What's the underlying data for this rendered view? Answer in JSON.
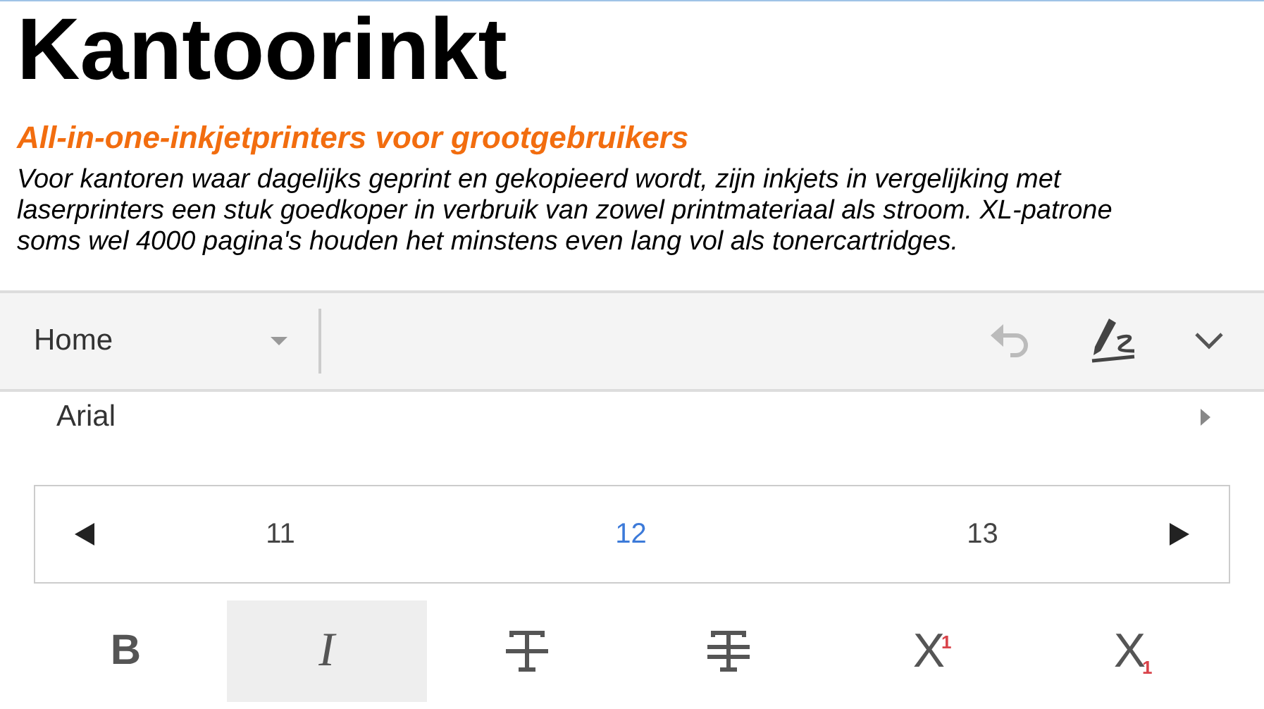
{
  "document": {
    "title": "Kantoorinkt",
    "subtitle": "All-in-one-inkjetprinters voor grootgebruikers",
    "paragraph_lines": [
      "Voor kantoren waar dagelijks geprint en gekopieerd wordt, zijn inkjets in vergelijking met",
      "laserprinters een stuk goedkoper in verbruik van zowel printmateriaal als stroom. XL-patrone",
      "soms wel 4000 pagina's houden het minstens even lang vol als tonercartridges."
    ]
  },
  "ribbon": {
    "tab": "Home",
    "undo_disabled": true
  },
  "font": {
    "name": "Arial"
  },
  "font_sizes": [
    {
      "label": "11",
      "selected": false
    },
    {
      "label": "12",
      "selected": true
    },
    {
      "label": "13",
      "selected": false
    }
  ],
  "format_buttons": [
    {
      "kind": "bold",
      "label": "B",
      "selected": false
    },
    {
      "kind": "italic",
      "label": "I",
      "selected": true
    },
    {
      "kind": "strike",
      "selected": false
    },
    {
      "kind": "double-strike",
      "selected": false
    },
    {
      "kind": "superscript",
      "label": "X",
      "index": "1",
      "selected": false
    },
    {
      "kind": "subscript",
      "label": "X",
      "index": "1",
      "selected": false
    }
  ]
}
